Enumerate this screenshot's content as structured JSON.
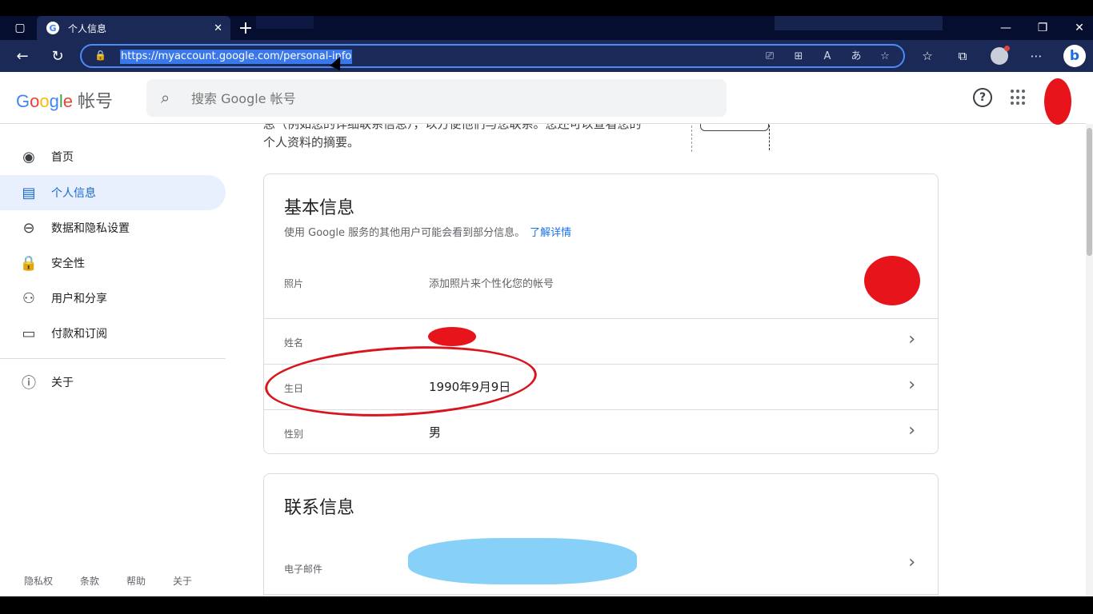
{
  "browser": {
    "tab_title": "个人信息",
    "url": "https://myaccount.google.com/personal-info"
  },
  "header": {
    "logo_letters": [
      "G",
      "o",
      "o",
      "g",
      "l",
      "e"
    ],
    "product": "帐号",
    "search_placeholder": "搜索 Google 帐号"
  },
  "intro": {
    "text": "息（例如您的详细联系信息），以方便他们与您联系。您还可以查看您的个人资料的摘要。"
  },
  "sidebar": {
    "items": [
      {
        "label": "首页",
        "icon": "account-circle-icon"
      },
      {
        "label": "个人信息",
        "icon": "id-card-icon"
      },
      {
        "label": "数据和隐私设置",
        "icon": "toggle-icon"
      },
      {
        "label": "安全性",
        "icon": "lock-icon"
      },
      {
        "label": "用户和分享",
        "icon": "people-icon"
      },
      {
        "label": "付款和订阅",
        "icon": "credit-card-icon"
      },
      {
        "label": "关于",
        "icon": "info-icon"
      }
    ],
    "active_index": 1,
    "footer": [
      "隐私权",
      "条款",
      "帮助",
      "关于"
    ]
  },
  "basic_info": {
    "title": "基本信息",
    "subtitle": "使用 Google 服务的其他用户可能会看到部分信息。",
    "learn_more": "了解详情",
    "rows": [
      {
        "label": "照片",
        "value": "添加照片来个性化您的帐号"
      },
      {
        "label": "姓名",
        "value": ""
      },
      {
        "label": "生日",
        "value": "1990年9月9日"
      },
      {
        "label": "性别",
        "value": "男"
      }
    ]
  },
  "contact_info": {
    "title": "联系信息",
    "rows": [
      {
        "label": "电子邮件",
        "value": ""
      }
    ]
  },
  "colors": {
    "accent": "#1a73e8",
    "active_bg": "#e8f0fe",
    "redaction_red": "#e8141c",
    "redaction_blue": "#87d0f7"
  }
}
